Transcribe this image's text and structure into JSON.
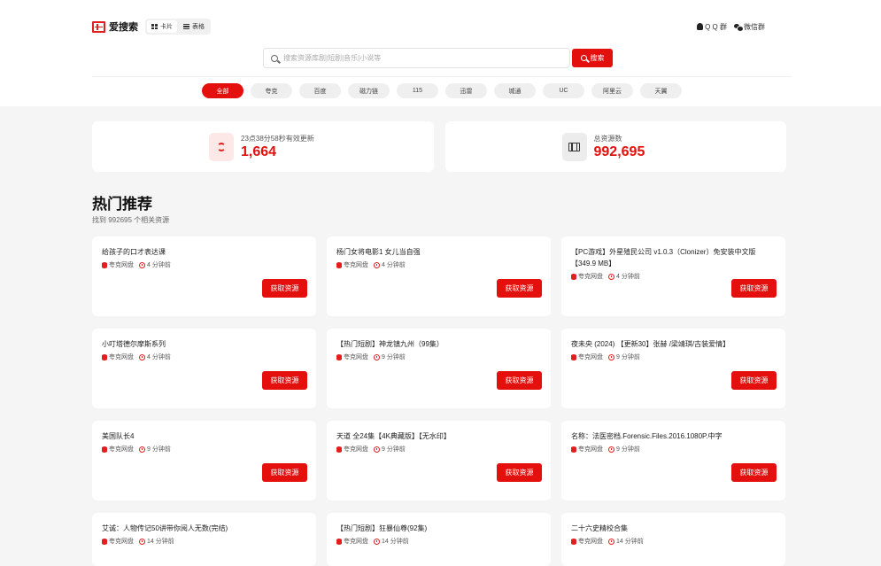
{
  "brand": {
    "name": "爱搜索"
  },
  "view_toggle": {
    "card_label": "卡片",
    "table_label": "表格"
  },
  "groups": {
    "qq_label": "Q Q 群",
    "wechat_label": "微信群"
  },
  "search": {
    "placeholder": "搜索资源库剧|短剧|音乐|小说等",
    "button_label": "搜索"
  },
  "filters": [
    "全部",
    "夸克",
    "百度",
    "磁力链",
    "115",
    "迅雷",
    "城通",
    "UC",
    "阿里云",
    "天翼"
  ],
  "stats": {
    "updated": {
      "label": "23点38分58秒有效更新",
      "value": "1,664"
    },
    "total": {
      "label": "总资源数",
      "value": "992,695"
    }
  },
  "section": {
    "title": "热门推荐",
    "subtitle": "找到 992695 个相关资源"
  },
  "card_button_label": "获取资源",
  "cards": [
    {
      "title": "给孩子的口才表达课",
      "source": "夸克网盘",
      "time": "4 分钟前"
    },
    {
      "title": "杨门女将电影1 女儿当自强",
      "source": "夸克网盘",
      "time": "4 分钟前"
    },
    {
      "title": "【PC游戏】外星殖民公司 v1.0.3（Clonizer）免安装中文版【349.9 MB】",
      "source": "夸克网盘",
      "time": "4 分钟前"
    },
    {
      "title": "小叮塔德尔摩斯系列",
      "source": "夸克网盘",
      "time": "4 分钟前"
    },
    {
      "title": "【热门短剧】神龙镇九州（99集）",
      "source": "夸克网盘",
      "time": "9 分钟前"
    },
    {
      "title": "夜未央 (2024) 【更新30】张赫 /梁靖琪/古装爱情】",
      "source": "夸克网盘",
      "time": "9 分钟前"
    },
    {
      "title": "美国队长4",
      "source": "夸克网盘",
      "time": "9 分钟前"
    },
    {
      "title": "天道 全24集【4K典藏版】【无水印】",
      "source": "夸克网盘",
      "time": "9 分钟前"
    },
    {
      "title": "名称：法医密档.Forensic.Files.2016.1080P.中字",
      "source": "夸克网盘",
      "time": "9 分钟前"
    },
    {
      "title": "艾诚：人物传记50讲带你阅人无数(完结)",
      "source": "夸克网盘",
      "time": "14 分钟前"
    },
    {
      "title": "【热门短剧】狂暴仙尊(92集)",
      "source": "夸克网盘",
      "time": "14 分钟前"
    },
    {
      "title": "二十六史精校合集",
      "source": "夸克网盘",
      "time": "14 分钟前"
    }
  ]
}
